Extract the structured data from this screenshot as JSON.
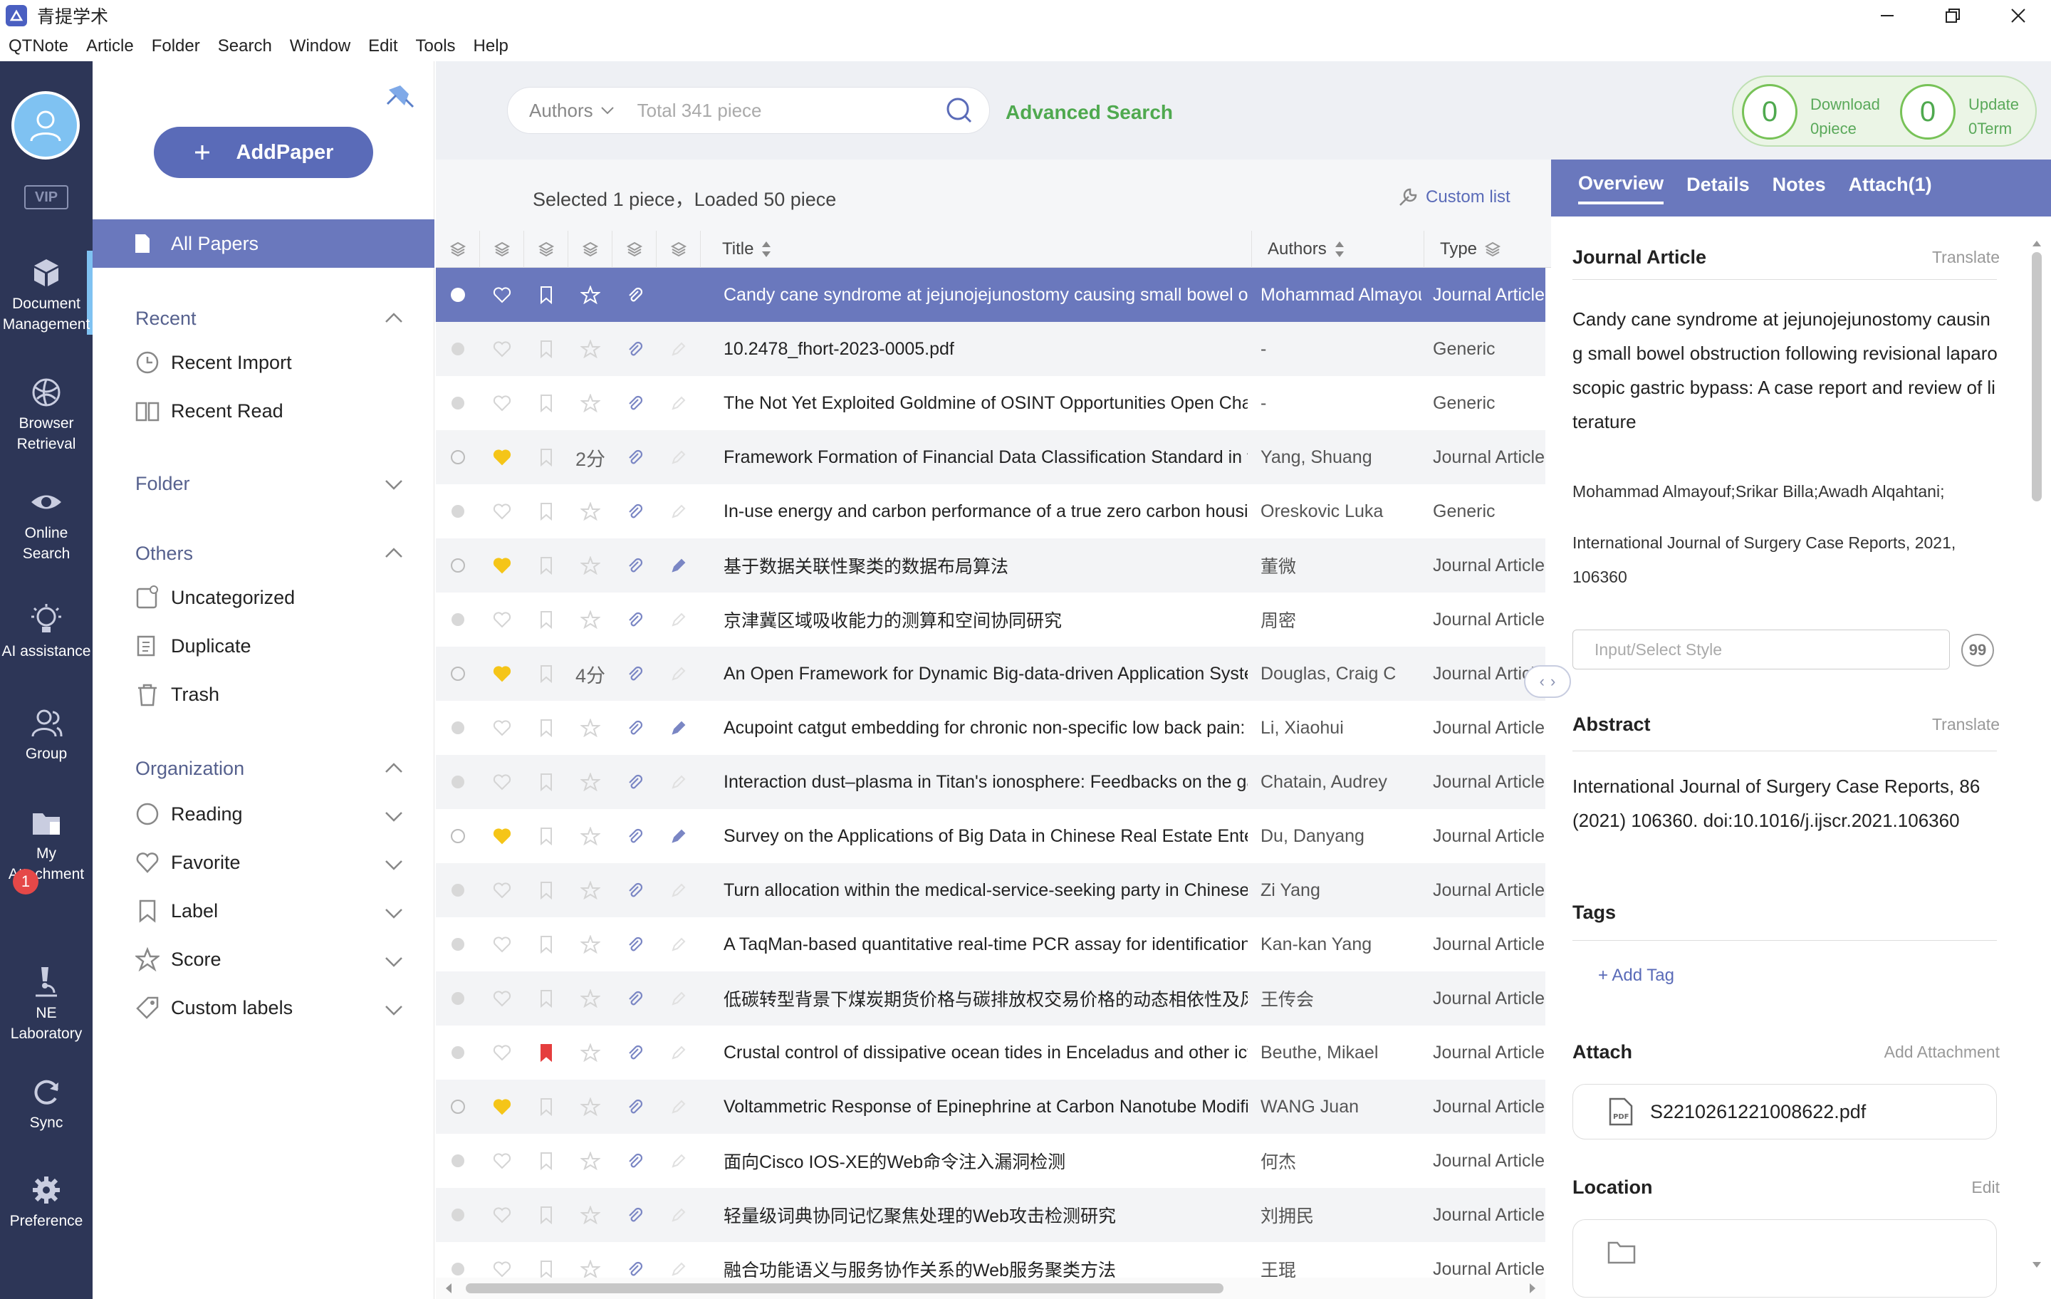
{
  "app": {
    "title": "青提学术"
  },
  "menu": [
    "QTNote",
    "Article",
    "Folder",
    "Search",
    "Window",
    "Edit",
    "Tools",
    "Help"
  ],
  "leftbar": {
    "vip": "VIP",
    "badge": "1",
    "items": [
      {
        "label": "Document\nManagement",
        "icon": "document-cube-icon"
      },
      {
        "label": "Browser\nRetrieval",
        "icon": "globe-icon"
      },
      {
        "label": "Online\nSearch",
        "icon": "eye-icon"
      },
      {
        "label": "AI assistance",
        "icon": "lightbulb-icon"
      },
      {
        "label": "Group",
        "icon": "group-icon"
      },
      {
        "label": "My\nAttachment",
        "icon": "folder-attachment-icon"
      },
      {
        "label": "NE\nLaboratory",
        "icon": "microscope-icon"
      },
      {
        "label": "Sync",
        "icon": "sync-icon"
      },
      {
        "label": "Preference",
        "icon": "gear-icon"
      }
    ]
  },
  "sidebar": {
    "add_paper": "AddPaper",
    "all_papers": "All Papers",
    "recent": {
      "label": "Recent",
      "items": [
        "Recent Import",
        "Recent Read"
      ]
    },
    "folder": "Folder",
    "others": {
      "label": "Others",
      "items": [
        "Uncategorized",
        "Duplicate",
        "Trash"
      ]
    },
    "organization": {
      "label": "Organization",
      "items": [
        "Reading",
        "Favorite",
        "Label",
        "Score",
        "Custom labels"
      ]
    }
  },
  "search": {
    "field": "Authors",
    "placeholder": "Total 341 piece",
    "advanced": "Advanced Search"
  },
  "download": {
    "count": "0",
    "label": "Download",
    "sub": "0piece"
  },
  "update": {
    "count": "0",
    "label": "Update",
    "sub": "0Term"
  },
  "list": {
    "selected_text": "Selected 1 piece，Loaded 50 piece",
    "custom_list": "Custom list",
    "columns": {
      "title": "Title",
      "authors": "Authors",
      "type": "Type"
    },
    "rows": [
      {
        "title": "Candy cane syndrome at jejunojejunostomy causing small bowel obstruction",
        "authors": "Mohammad Almayouf",
        "type": "Journal Article",
        "fav": false,
        "bookmark": false,
        "score": "",
        "edit": false,
        "selected": true
      },
      {
        "title": "10.2478_fhort-2023-0005.pdf",
        "authors": "-",
        "type": "Generic",
        "fav": false,
        "bookmark": false,
        "score": "",
        "edit": false
      },
      {
        "title": "The Not Yet Exploited Goldmine of OSINT Opportunities Open Challenges",
        "authors": "-",
        "type": "Generic",
        "fav": false,
        "bookmark": false,
        "score": "",
        "edit": false
      },
      {
        "title": "Framework Formation of Financial Data Classification Standard in the",
        "authors": "Yang, Shuang",
        "type": "Journal Article",
        "fav": true,
        "bookmark": false,
        "score": "2分",
        "edit": false
      },
      {
        "title": "In-use energy and carbon performance of a true zero carbon housing",
        "authors": "Oreskovic Luka",
        "type": "Generic",
        "fav": false,
        "bookmark": false,
        "score": "",
        "edit": false
      },
      {
        "title": "基于数据关联性聚类的数据布局算法",
        "authors": "董微",
        "type": "Journal Article",
        "fav": true,
        "bookmark": false,
        "score": "",
        "edit": true
      },
      {
        "title": "京津冀区域吸收能力的测算和空间协同研究",
        "authors": "周密",
        "type": "Journal Article",
        "fav": false,
        "bookmark": false,
        "score": "",
        "edit": false
      },
      {
        "title": "An Open Framework for Dynamic Big-data-driven Application Systems",
        "authors": "Douglas, Craig C",
        "type": "Journal Article",
        "fav": true,
        "bookmark": false,
        "score": "4分",
        "edit": false
      },
      {
        "title": "Acupoint catgut embedding for chronic non-specific low back pain: A",
        "authors": "Li, Xiaohui",
        "type": "Journal Article",
        "fav": false,
        "bookmark": false,
        "score": "",
        "edit": true
      },
      {
        "title": "Interaction dust–plasma in Titan's ionosphere: Feedbacks on the gas phase",
        "authors": "Chatain, Audrey",
        "type": "Journal Article",
        "fav": false,
        "bookmark": false,
        "score": "",
        "edit": false
      },
      {
        "title": "Survey on the Applications of Big Data in Chinese Real Estate Enterprises",
        "authors": "Du, Danyang",
        "type": "Journal Article",
        "fav": true,
        "bookmark": false,
        "score": "",
        "edit": true
      },
      {
        "title": "Turn allocation within the medical-service-seeking party in Chinese acute",
        "authors": "Zi Yang",
        "type": "Journal Article",
        "fav": false,
        "bookmark": false,
        "score": "",
        "edit": false
      },
      {
        "title": "A TaqMan-based quantitative real-time PCR assay for identification of",
        "authors": "Kan-kan Yang",
        "type": "Journal Article",
        "fav": false,
        "bookmark": false,
        "score": "",
        "edit": false
      },
      {
        "title": "低碳转型背景下煤炭期货价格与碳排放权交易价格的动态相依性及风险",
        "authors": "王传会",
        "type": "Journal Article",
        "fav": false,
        "bookmark": false,
        "score": "",
        "edit": false
      },
      {
        "title": "Crustal control of dissipative ocean tides in Enceladus and other icy moons",
        "authors": "Beuthe, Mikael",
        "type": "Journal Article",
        "fav": false,
        "bookmark": true,
        "score": "",
        "edit": false
      },
      {
        "title": "Voltammetric Response of Epinephrine at Carbon Nanotube Modified",
        "authors": "WANG Juan",
        "type": "Journal Article",
        "fav": true,
        "bookmark": false,
        "score": "",
        "edit": false
      },
      {
        "title": "面向Cisco IOS-XE的Web命令注入漏洞检测",
        "authors": "何杰",
        "type": "Journal Article",
        "fav": false,
        "bookmark": false,
        "score": "",
        "edit": false
      },
      {
        "title": "轻量级词典协同记忆聚焦处理的Web攻击检测研究",
        "authors": "刘拥民",
        "type": "Journal Article",
        "fav": false,
        "bookmark": false,
        "score": "",
        "edit": false
      },
      {
        "title": "融合功能语义与服务协作关系的Web服务聚类方法",
        "authors": "王琨",
        "type": "Journal Article",
        "fav": false,
        "bookmark": false,
        "score": "",
        "edit": false
      }
    ]
  },
  "detail": {
    "tabs": [
      "Overview",
      "Details",
      "Notes",
      "Attach(1)"
    ],
    "type": "Journal Article",
    "translate": "Translate",
    "title": "Candy cane syndrome at jejunojejunostomy causing small bowel obstruction following revisional laparoscopic gastric bypass: A case report and review of literature",
    "authors": "Mohammad Almayouf;Srikar Billa;Awadh Alqahtani;",
    "journal": "International Journal of Surgery Case Reports, 2021, 106360",
    "style_placeholder": "Input/Select Style",
    "abstract_label": "Abstract",
    "abstract": "International Journal of Surgery Case Reports, 86 (2021) 106360. doi:10.1016/j.ijscr.2021.106360",
    "tags_label": "Tags",
    "add_tag": "+ Add Tag",
    "attach_label": "Attach",
    "add_attachment": "Add Attachment",
    "attachment_file": "S2210261221008622.pdf",
    "location_label": "Location",
    "location_edit": "Edit"
  },
  "colors": {
    "sidebar_dark": "#2d3657",
    "accent": "#6a78bd",
    "green": "#4fa94f",
    "heart": "#f5c518",
    "bookmark_red": "#e53e3e"
  }
}
